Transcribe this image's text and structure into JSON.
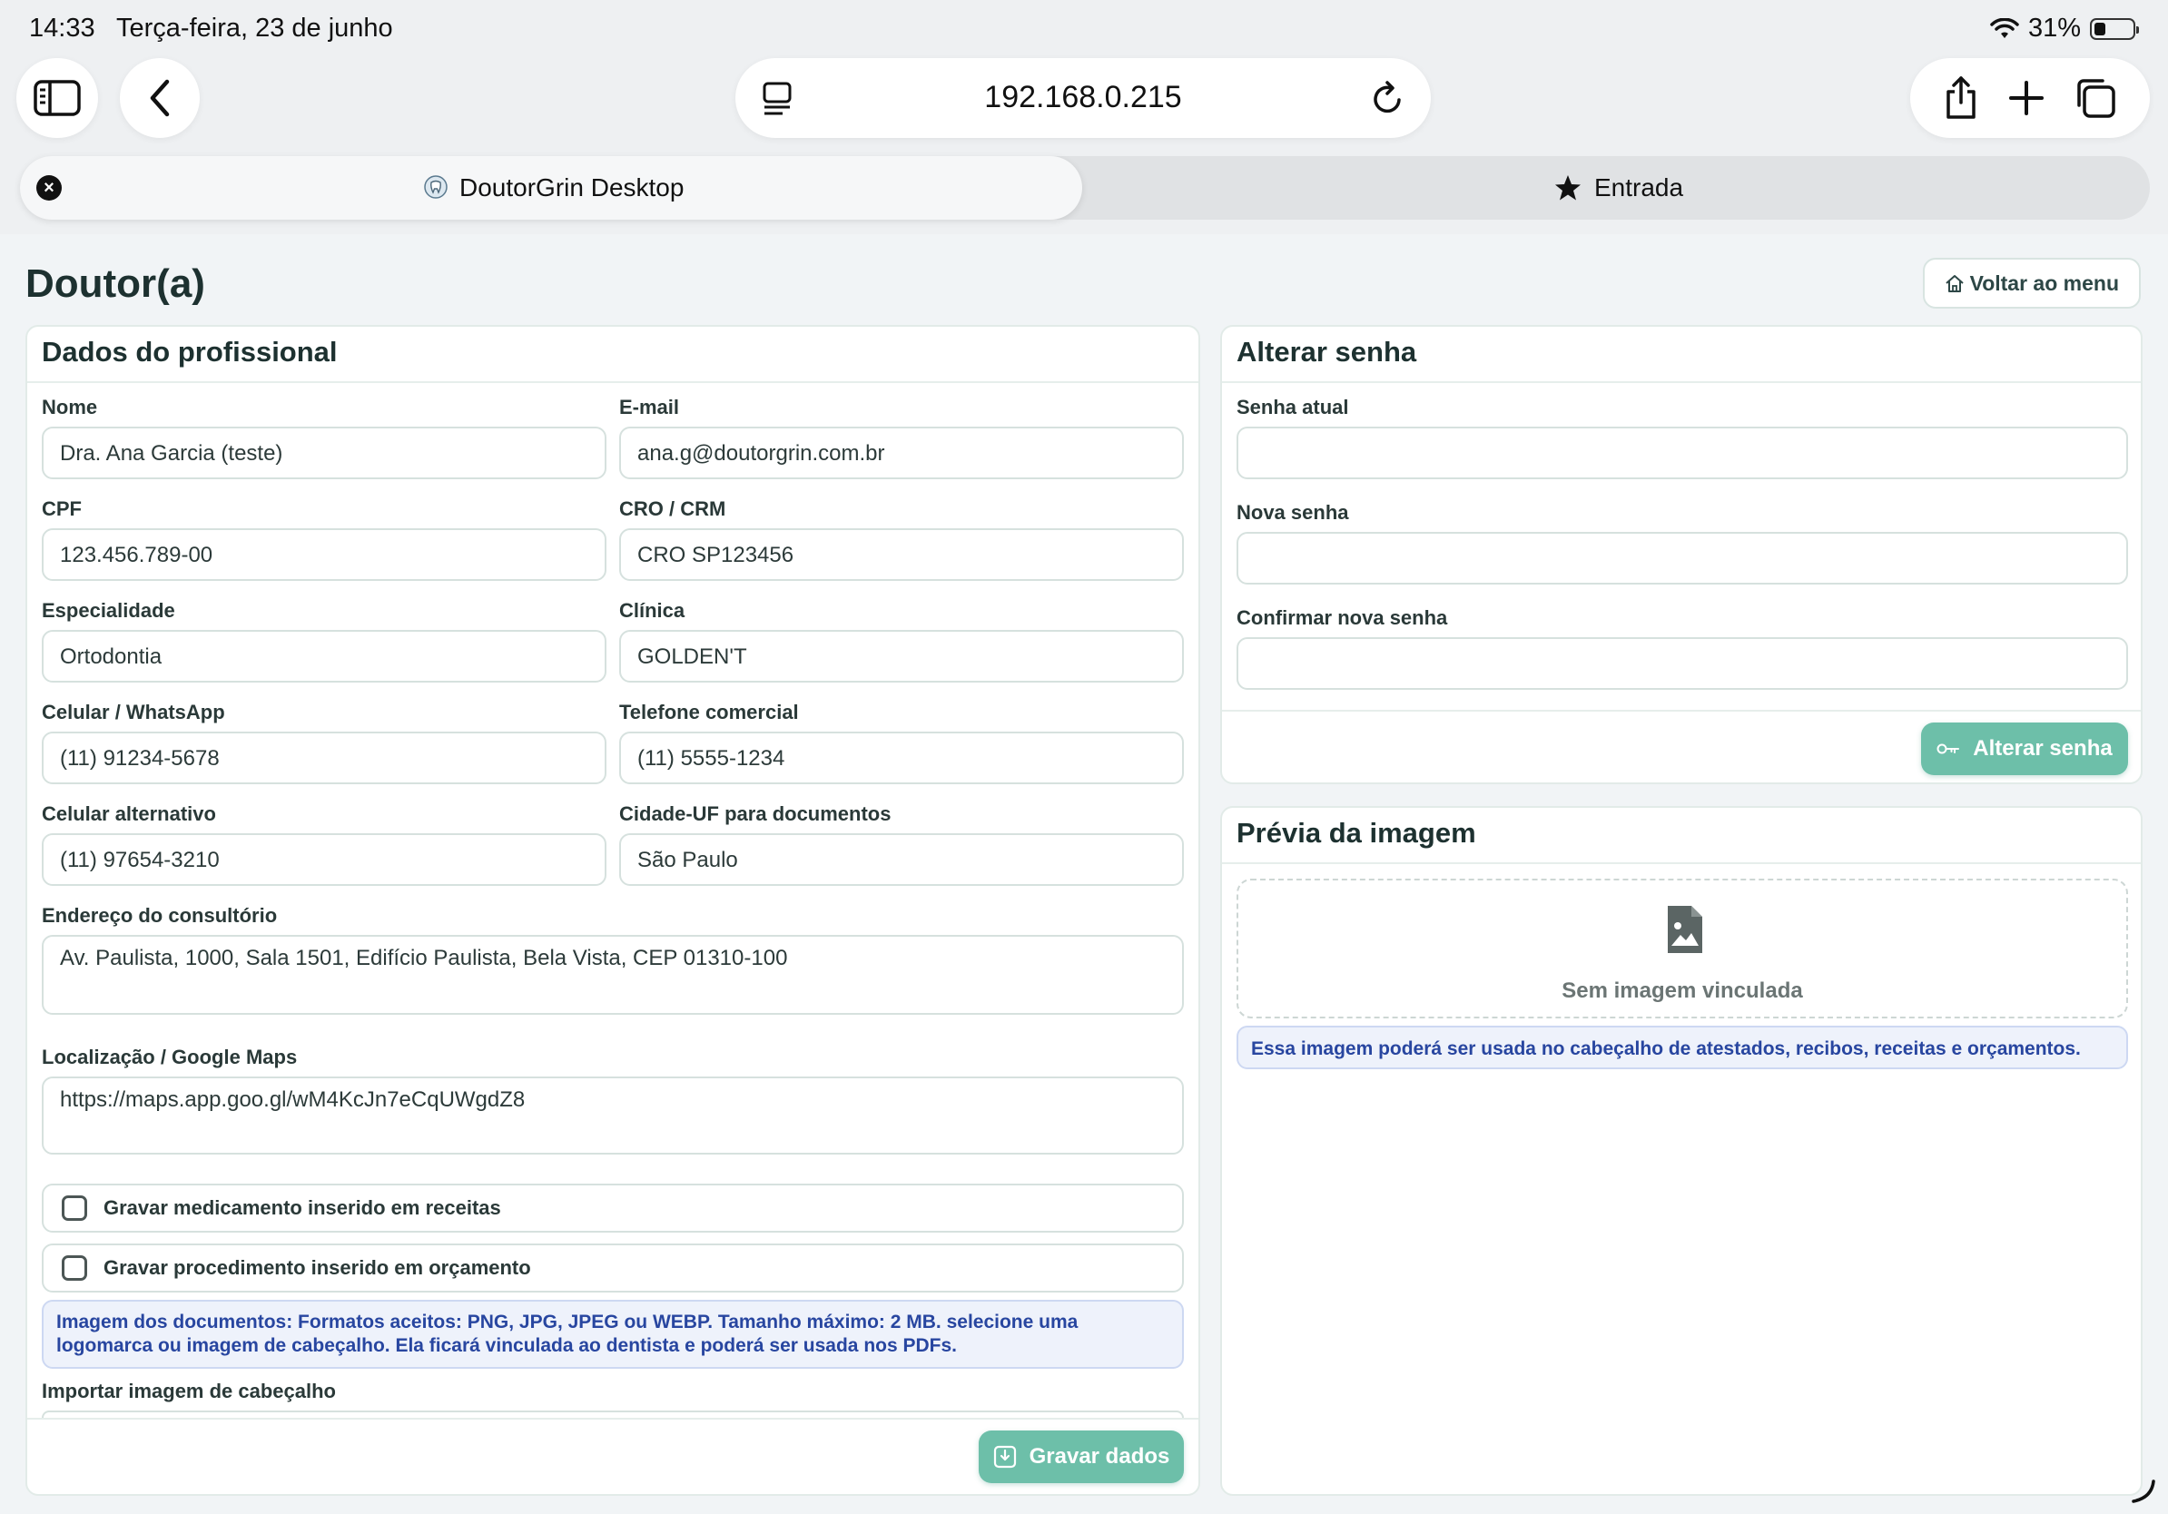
{
  "statusbar": {
    "time": "14:33",
    "date": "Terça-feira, 23 de junho",
    "battery": "31%",
    "battery_level": 0.31
  },
  "browser": {
    "url": "192.168.0.215",
    "tabs": [
      {
        "label": "DoutorGrin Desktop",
        "active": true
      },
      {
        "label": "Entrada",
        "active": false
      }
    ],
    "icons": [
      "sidebar-icon",
      "back-icon",
      "reader-icon",
      "reload-icon",
      "share-icon",
      "plus-icon",
      "tabs-icon"
    ]
  },
  "page": {
    "title": "Doutor(a)",
    "back_menu": "Voltar ao menu"
  },
  "profile": {
    "heading": "Dados do profissional",
    "fields": {
      "nome": {
        "label": "Nome",
        "value": "Dra. Ana Garcia (teste)"
      },
      "email": {
        "label": "E-mail",
        "value": "ana.g@doutorgrin.com.br"
      },
      "cpf": {
        "label": "CPF",
        "value": "123.456.789-00"
      },
      "cro": {
        "label": "CRO / CRM",
        "value": "CRO SP123456"
      },
      "especialidade": {
        "label": "Especialidade",
        "value": "Ortodontia"
      },
      "clinica": {
        "label": "Clínica",
        "value": "GOLDEN'T"
      },
      "celular": {
        "label": "Celular / WhatsApp",
        "value": "(11) 91234-5678"
      },
      "telefone": {
        "label": "Telefone comercial",
        "value": "(11) 5555-1234"
      },
      "celular_alt": {
        "label": "Celular alternativo",
        "value": "(11) 97654-3210"
      },
      "cidade": {
        "label": "Cidade-UF para documentos",
        "value": "São Paulo"
      },
      "endereco": {
        "label": "Endereço do consultório",
        "value": "Av. Paulista, 1000, Sala 1501, Edifício Paulista, Bela Vista, CEP 01310-100"
      },
      "maps": {
        "label": "Localização / Google Maps",
        "value": "https://maps.app.goo.gl/wM4KcJn7eCqUWgdZ8"
      }
    },
    "checks": {
      "medicamento": "Gravar medicamento inserido em receitas",
      "procedimento": "Gravar procedimento inserido em orçamento"
    },
    "info_line1": "Imagem dos documentos: Formatos aceitos: PNG, JPG, JPEG ou WEBP. Tamanho máximo: 2 MB. selecione uma",
    "info_line2": "logomarca ou imagem de cabeçalho. Ela ficará vinculada ao dentista e poderá ser usada nos PDFs.",
    "import_label": "Importar imagem de cabeçalho",
    "save_button": "Gravar dados"
  },
  "password": {
    "heading": "Alterar senha",
    "current_label": "Senha atual",
    "new_label": "Nova senha",
    "confirm_label": "Confirmar nova senha",
    "button": "Alterar senha"
  },
  "preview": {
    "heading": "Prévia da imagem",
    "empty_text": "Sem imagem vinculada",
    "info": "Essa imagem poderá ser usada no cabeçalho de atestados, recibos, receitas e orçamentos."
  },
  "colors": {
    "accent": "#6dbfa9",
    "info_text": "#2846a0",
    "title": "#1d3130"
  }
}
